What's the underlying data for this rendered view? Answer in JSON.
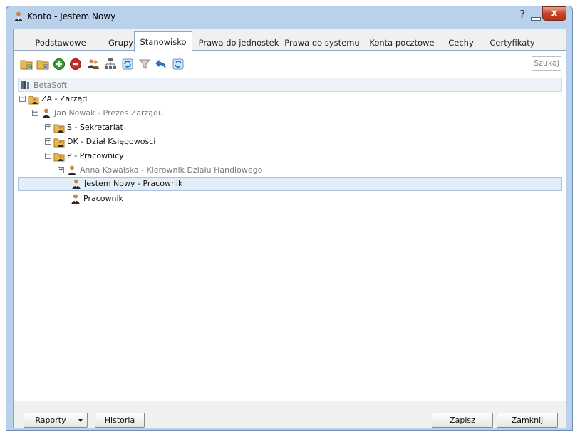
{
  "window": {
    "title": "Konto - Jestem Nowy",
    "help_label": "?",
    "close_label": "x"
  },
  "tabs": [
    {
      "label": "Podstawowe",
      "active": false
    },
    {
      "label": "Grupy",
      "active": false
    },
    {
      "label": "Stanowisko",
      "active": true
    },
    {
      "label": "Prawa do jednostek",
      "active": false
    },
    {
      "label": "Prawa do systemu",
      "active": false
    },
    {
      "label": "Konta pocztowe",
      "active": false
    },
    {
      "label": "Cechy",
      "active": false
    },
    {
      "label": "Certyfikaty",
      "active": false
    }
  ],
  "toolbar": {
    "icons": [
      "add-folder-icon",
      "add-subfolder-icon",
      "add-icon",
      "remove-icon",
      "users-icon",
      "org-chart-icon",
      "refresh-icon",
      "filter-icon",
      "undo-icon",
      "sync-icon"
    ],
    "search_label": "Szukaj"
  },
  "tree": {
    "root": "BetaSoft",
    "nodes": [
      {
        "label": "ZA - Zarząd",
        "type": "dept",
        "toggle": "−"
      },
      {
        "label": "Jan Nowak - Prezes Zarządu",
        "type": "person",
        "toggle": "−"
      },
      {
        "label": "S - Sekretariat",
        "type": "dept",
        "toggle": "+"
      },
      {
        "label": "DK - Dział Księgowości",
        "type": "dept",
        "toggle": "+"
      },
      {
        "label": "P - Pracownicy",
        "type": "dept",
        "toggle": "−"
      },
      {
        "label": "Anna Kowalska - Kierownik Działu Handlowego",
        "type": "person",
        "toggle": "+"
      },
      {
        "label": "Jestem Nowy - Pracownik",
        "type": "person-active",
        "selected": true
      },
      {
        "label": "Pracownik",
        "type": "person-active"
      }
    ]
  },
  "footer": {
    "reports_label": "Raporty",
    "history_label": "Historia",
    "save_label": "Zapisz",
    "close_label": "Zamknij"
  },
  "colors": {
    "frame": "#b9d1ea",
    "selection": "#e5eef8",
    "add_green": "#2e9e2e",
    "remove_red": "#cc2a2a",
    "close_red": "#c8432a"
  }
}
